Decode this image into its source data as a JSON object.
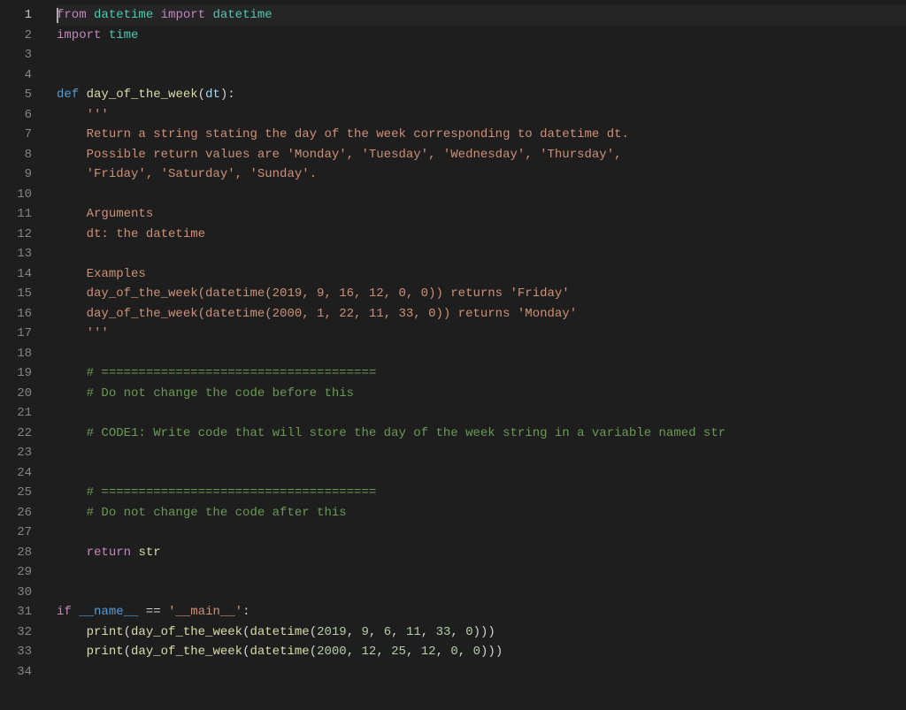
{
  "editor": {
    "language": "python",
    "active_line": 1,
    "cursor_col": 0,
    "line_count": 34,
    "lines": [
      {
        "n": 1,
        "active": true,
        "tokens": [
          {
            "c": "tok-kw",
            "t": "from"
          },
          {
            "c": "tok-pl",
            "t": " "
          },
          {
            "c": "tok-mod",
            "t": "datetime"
          },
          {
            "c": "tok-pl",
            "t": " "
          },
          {
            "c": "tok-kw",
            "t": "import"
          },
          {
            "c": "tok-pl",
            "t": " "
          },
          {
            "c": "tok-mod",
            "t": "datetime"
          }
        ]
      },
      {
        "n": 2,
        "tokens": [
          {
            "c": "tok-kw",
            "t": "import"
          },
          {
            "c": "tok-pl",
            "t": " "
          },
          {
            "c": "tok-mod",
            "t": "time"
          }
        ]
      },
      {
        "n": 3,
        "tokens": []
      },
      {
        "n": 4,
        "tokens": []
      },
      {
        "n": 5,
        "tokens": [
          {
            "c": "tok-def",
            "t": "def"
          },
          {
            "c": "tok-pl",
            "t": " "
          },
          {
            "c": "tok-fn",
            "t": "day_of_the_week"
          },
          {
            "c": "tok-pn",
            "t": "("
          },
          {
            "c": "tok-id",
            "t": "dt"
          },
          {
            "c": "tok-pn",
            "t": ")"
          },
          {
            "c": "tok-pn",
            "t": ":"
          }
        ]
      },
      {
        "n": 6,
        "tokens": [
          {
            "c": "tok-pl",
            "t": "    "
          },
          {
            "c": "tok-doc",
            "t": "'''"
          }
        ]
      },
      {
        "n": 7,
        "tokens": [
          {
            "c": "tok-pl",
            "t": "    "
          },
          {
            "c": "tok-doc",
            "t": "Return a string stating the day of the week corresponding to datetime dt."
          }
        ]
      },
      {
        "n": 8,
        "tokens": [
          {
            "c": "tok-pl",
            "t": "    "
          },
          {
            "c": "tok-doc",
            "t": "Possible return values are 'Monday', 'Tuesday', 'Wednesday', 'Thursday',"
          }
        ]
      },
      {
        "n": 9,
        "tokens": [
          {
            "c": "tok-pl",
            "t": "    "
          },
          {
            "c": "tok-doc",
            "t": "'Friday', 'Saturday', 'Sunday'."
          }
        ]
      },
      {
        "n": 10,
        "tokens": []
      },
      {
        "n": 11,
        "tokens": [
          {
            "c": "tok-pl",
            "t": "    "
          },
          {
            "c": "tok-doc",
            "t": "Arguments"
          }
        ]
      },
      {
        "n": 12,
        "tokens": [
          {
            "c": "tok-pl",
            "t": "    "
          },
          {
            "c": "tok-doc",
            "t": "dt: the datetime"
          }
        ]
      },
      {
        "n": 13,
        "tokens": []
      },
      {
        "n": 14,
        "tokens": [
          {
            "c": "tok-pl",
            "t": "    "
          },
          {
            "c": "tok-doc",
            "t": "Examples"
          }
        ]
      },
      {
        "n": 15,
        "tokens": [
          {
            "c": "tok-pl",
            "t": "    "
          },
          {
            "c": "tok-doc",
            "t": "day_of_the_week(datetime(2019, 9, 16, 12, 0, 0)) returns 'Friday'"
          }
        ]
      },
      {
        "n": 16,
        "tokens": [
          {
            "c": "tok-pl",
            "t": "    "
          },
          {
            "c": "tok-doc",
            "t": "day_of_the_week(datetime(2000, 1, 22, 11, 33, 0)) returns 'Monday'"
          }
        ]
      },
      {
        "n": 17,
        "tokens": [
          {
            "c": "tok-pl",
            "t": "    "
          },
          {
            "c": "tok-doc",
            "t": "'''"
          }
        ]
      },
      {
        "n": 18,
        "tokens": []
      },
      {
        "n": 19,
        "tokens": [
          {
            "c": "tok-pl",
            "t": "    "
          },
          {
            "c": "tok-cmt",
            "t": "# ====================================="
          }
        ]
      },
      {
        "n": 20,
        "tokens": [
          {
            "c": "tok-pl",
            "t": "    "
          },
          {
            "c": "tok-cmt",
            "t": "# Do not change the code before this"
          }
        ]
      },
      {
        "n": 21,
        "tokens": []
      },
      {
        "n": 22,
        "tokens": [
          {
            "c": "tok-pl",
            "t": "    "
          },
          {
            "c": "tok-cmt",
            "t": "# CODE1: Write code that will store the day of the week string in a variable named str"
          }
        ]
      },
      {
        "n": 23,
        "tokens": []
      },
      {
        "n": 24,
        "tokens": []
      },
      {
        "n": 25,
        "tokens": [
          {
            "c": "tok-pl",
            "t": "    "
          },
          {
            "c": "tok-cmt",
            "t": "# ====================================="
          }
        ]
      },
      {
        "n": 26,
        "tokens": [
          {
            "c": "tok-pl",
            "t": "    "
          },
          {
            "c": "tok-cmt",
            "t": "# Do not change the code after this"
          }
        ]
      },
      {
        "n": 27,
        "tokens": []
      },
      {
        "n": 28,
        "tokens": [
          {
            "c": "tok-pl",
            "t": "    "
          },
          {
            "c": "tok-kw",
            "t": "return"
          },
          {
            "c": "tok-pl",
            "t": " "
          },
          {
            "c": "tok-bfn",
            "t": "str"
          }
        ]
      },
      {
        "n": 29,
        "tokens": []
      },
      {
        "n": 30,
        "tokens": []
      },
      {
        "n": 31,
        "tokens": [
          {
            "c": "tok-kw",
            "t": "if"
          },
          {
            "c": "tok-pl",
            "t": " "
          },
          {
            "c": "tok-var",
            "t": "__name__"
          },
          {
            "c": "tok-pl",
            "t": " "
          },
          {
            "c": "tok-op",
            "t": "=="
          },
          {
            "c": "tok-pl",
            "t": " "
          },
          {
            "c": "tok-str",
            "t": "'__main__'"
          },
          {
            "c": "tok-pn",
            "t": ":"
          }
        ]
      },
      {
        "n": 32,
        "tokens": [
          {
            "c": "tok-pl",
            "t": "    "
          },
          {
            "c": "tok-bfn",
            "t": "print"
          },
          {
            "c": "tok-pn",
            "t": "("
          },
          {
            "c": "tok-fn",
            "t": "day_of_the_week"
          },
          {
            "c": "tok-pn",
            "t": "("
          },
          {
            "c": "tok-fn",
            "t": "datetime"
          },
          {
            "c": "tok-pn",
            "t": "("
          },
          {
            "c": "tok-num",
            "t": "2019"
          },
          {
            "c": "tok-pn",
            "t": ", "
          },
          {
            "c": "tok-num",
            "t": "9"
          },
          {
            "c": "tok-pn",
            "t": ", "
          },
          {
            "c": "tok-num",
            "t": "6"
          },
          {
            "c": "tok-pn",
            "t": ", "
          },
          {
            "c": "tok-num",
            "t": "11"
          },
          {
            "c": "tok-pn",
            "t": ", "
          },
          {
            "c": "tok-num",
            "t": "33"
          },
          {
            "c": "tok-pn",
            "t": ", "
          },
          {
            "c": "tok-num",
            "t": "0"
          },
          {
            "c": "tok-pn",
            "t": ")))"
          }
        ]
      },
      {
        "n": 33,
        "tokens": [
          {
            "c": "tok-pl",
            "t": "    "
          },
          {
            "c": "tok-bfn",
            "t": "print"
          },
          {
            "c": "tok-pn",
            "t": "("
          },
          {
            "c": "tok-fn",
            "t": "day_of_the_week"
          },
          {
            "c": "tok-pn",
            "t": "("
          },
          {
            "c": "tok-fn",
            "t": "datetime"
          },
          {
            "c": "tok-pn",
            "t": "("
          },
          {
            "c": "tok-num",
            "t": "2000"
          },
          {
            "c": "tok-pn",
            "t": ", "
          },
          {
            "c": "tok-num",
            "t": "12"
          },
          {
            "c": "tok-pn",
            "t": ", "
          },
          {
            "c": "tok-num",
            "t": "25"
          },
          {
            "c": "tok-pn",
            "t": ", "
          },
          {
            "c": "tok-num",
            "t": "12"
          },
          {
            "c": "tok-pn",
            "t": ", "
          },
          {
            "c": "tok-num",
            "t": "0"
          },
          {
            "c": "tok-pn",
            "t": ", "
          },
          {
            "c": "tok-num",
            "t": "0"
          },
          {
            "c": "tok-pn",
            "t": ")))"
          }
        ]
      },
      {
        "n": 34,
        "tokens": []
      }
    ]
  }
}
